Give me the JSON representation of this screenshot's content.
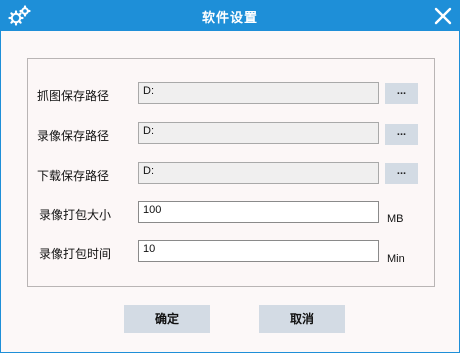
{
  "window": {
    "title": "软件设置",
    "accent": "#1e8fd8"
  },
  "icons": {
    "settings": "gear-icon",
    "close": "close-icon"
  },
  "paths": [
    {
      "label": "抓图保存路径",
      "value": "D:",
      "browse_label": "..."
    },
    {
      "label": "录像保存路径",
      "value": "D:",
      "browse_label": "..."
    },
    {
      "label": "下载保存路径",
      "value": "D:",
      "browse_label": "..."
    }
  ],
  "pack_size": {
    "label": "录像打包大小",
    "value": "100",
    "unit": "MB"
  },
  "pack_time": {
    "label": "录像打包时间",
    "value": "10",
    "unit": "Min"
  },
  "buttons": {
    "ok": "确定",
    "cancel": "取消"
  }
}
